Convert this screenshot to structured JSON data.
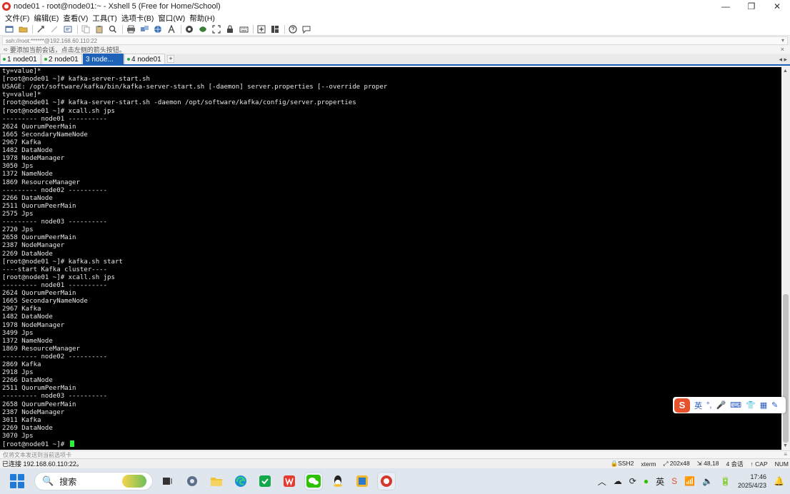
{
  "window": {
    "title": "node01 - root@node01:~ - Xshell 5 (Free for Home/School)",
    "min": "—",
    "max": "❐",
    "close": "✕"
  },
  "menu": [
    "文件(F)",
    "编辑(E)",
    "查看(V)",
    "工具(T)",
    "选项卡(B)",
    "窗口(W)",
    "帮助(H)"
  ],
  "toolbar_icons": [
    "new-session-icon",
    "open-folder-icon",
    "reconnect-icon",
    "disconnect-icon",
    "properties-icon",
    "copy-icon",
    "paste-icon",
    "find-icon",
    "print-icon",
    "transfer-icon",
    "globe-icon",
    "font-icon",
    "xftp-icon",
    "tunnel-icon",
    "fullscreen-icon",
    "lock-icon",
    "keyboard-icon",
    "add-icon",
    "layout-icon",
    "help-icon",
    "chat-icon"
  ],
  "address": {
    "value": "ssh://root:******@192.168.60.110:22",
    "arrow": "▾"
  },
  "hint": {
    "text": "要添加当前会话，点击左侧的箭头按钮。",
    "close": "×"
  },
  "tabs": [
    {
      "label": "1 node01",
      "active": false
    },
    {
      "label": "2 node01",
      "active": false
    },
    {
      "label": "3 node...",
      "active": true
    },
    {
      "label": "4 node01",
      "active": false
    }
  ],
  "tab_add": "+",
  "tab_nav": "◂ ▸",
  "terminal": {
    "lines": [
      "ty=value]*",
      "[root@node01 ~]# kafka-server-start.sh",
      "USAGE: /opt/software/kafka/bin/kafka-server-start.sh [-daemon] server.properties [--override proper",
      "ty=value]*",
      "[root@node01 ~]# kafka-server-start.sh -daemon /opt/software/kafka/config/server.properties",
      "[root@node01 ~]# xcall.sh jps",
      "--------- node01 ----------",
      "2624 QuorumPeerMain",
      "1665 SecondaryNameNode",
      "2967 Kafka",
      "1482 DataNode",
      "1978 NodeManager",
      "3050 Jps",
      "1372 NameNode",
      "1869 ResourceManager",
      "--------- node02 ----------",
      "2266 DataNode",
      "2511 QuorumPeerMain",
      "2575 Jps",
      "--------- node03 ----------",
      "2720 Jps",
      "2658 QuorumPeerMain",
      "2387 NodeManager",
      "2269 DataNode",
      "[root@node01 ~]# kafka.sh start",
      "----start Kafka cluster----",
      "[root@node01 ~]# xcall.sh jps",
      "--------- node01 ----------",
      "2624 QuorumPeerMain",
      "1665 SecondaryNameNode",
      "2967 Kafka",
      "1482 DataNode",
      "1978 NodeManager",
      "3499 Jps",
      "1372 NameNode",
      "1869 ResourceManager",
      "--------- node02 ----------",
      "2869 Kafka",
      "2918 Jps",
      "2266 DataNode",
      "2511 QuorumPeerMain",
      "--------- node03 ----------",
      "2658 QuorumPeerMain",
      "2387 NodeManager",
      "3011 Kafka",
      "2269 DataNode",
      "3070 Jps"
    ],
    "prompt": "[root@node01 ~]# ",
    "cursor_color": "#2ff03d"
  },
  "ime": {
    "logo": "S",
    "mode": "英",
    "punct": "°,",
    "mic": "🎤",
    "keyboard": "⌨",
    "skin": "👕",
    "grid": "▦",
    "tools": "✎"
  },
  "input_hint": {
    "text": "仅将文本发送到当前选项卡",
    "right": "≡"
  },
  "status": {
    "left": "已连接 192.168.60.110:22。",
    "protocol": "SSH2",
    "term": "xterm",
    "size": "202x48",
    "cursor": "48,18",
    "sessions": "4 会话",
    "caps": "CAP",
    "num": "NUM"
  },
  "taskbar": {
    "search_label": "搜索",
    "apps": [
      "task-view",
      "settings",
      "file-explorer",
      "edge",
      "wechat-work",
      "wps",
      "wechat",
      "qq",
      "screenshot",
      "xshell"
    ],
    "tray": {
      "chevron": "︿",
      "clock_time": "17:46",
      "clock_date": "2025/4/23"
    }
  }
}
